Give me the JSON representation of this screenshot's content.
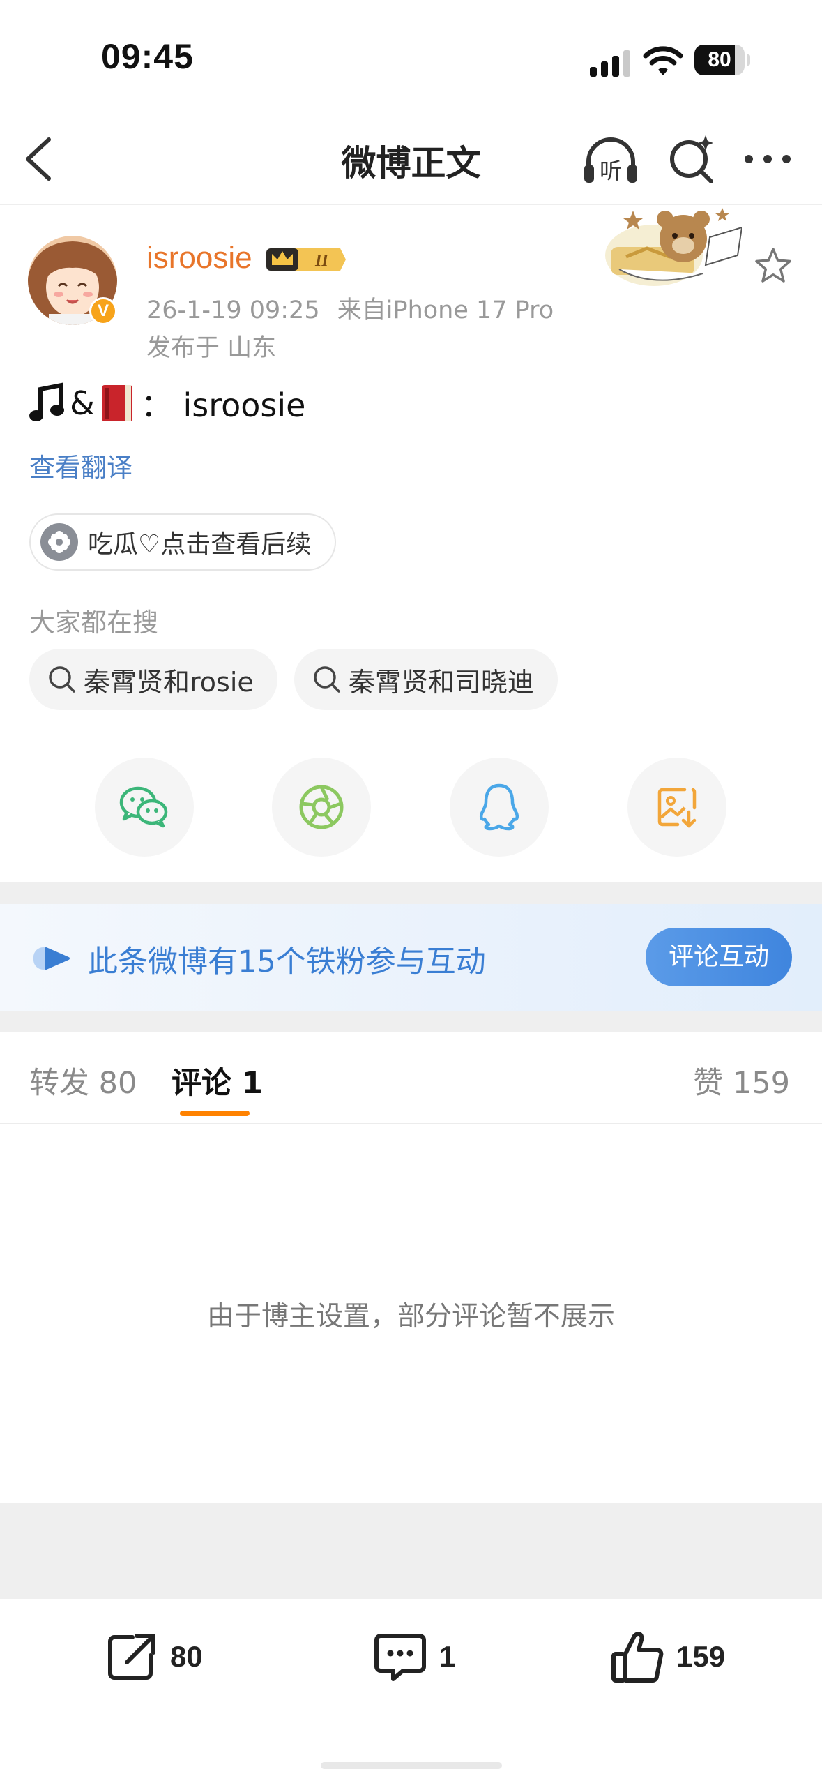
{
  "status_bar": {
    "time": "09:45",
    "battery": "80",
    "battery_level": 0.8
  },
  "navbar": {
    "title": "微博正文"
  },
  "post": {
    "username": "isroosie",
    "badge_text": "II",
    "timestamp": "26-1-19 09:25",
    "source": "来自iPhone 17 Pro",
    "location": "发布于 山东",
    "content_separator": "&",
    "content_text": "：  isroosie",
    "translate_link": "查看翻译",
    "topic_chip": "吃瓜♡点击查看后续",
    "hot_search_label": "大家都在搜",
    "hot_searches": [
      "秦霄贤和rosie",
      "秦霄贤和司晓迪"
    ]
  },
  "share_icons": [
    "wechat-icon",
    "moments-icon",
    "qq-icon",
    "save-image-icon"
  ],
  "fan_banner": {
    "text": "此条微博有15个铁粉参与互动",
    "button": "评论互动"
  },
  "tabs": {
    "repost": "转发 80",
    "comment": "评论 1",
    "like": "赞 159"
  },
  "comments_notice": "由于博主设置，部分评论暂不展示",
  "bottom_bar": {
    "repost_count": "80",
    "comment_count": "1",
    "like_count": "159"
  },
  "colors": {
    "username": "#e8752a",
    "link": "#4a7fc6",
    "accent": "#ff8200",
    "banner_text": "#3a7ed3"
  }
}
